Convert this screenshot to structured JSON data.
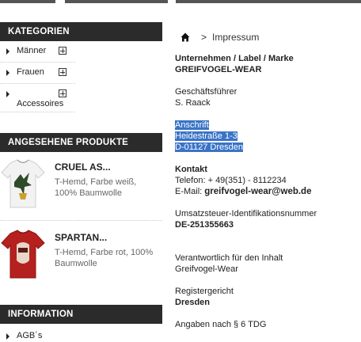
{
  "sidebar": {
    "categories_title": "KATEGORIEN",
    "categories": [
      {
        "label": "Männer"
      },
      {
        "label": "Frauen"
      },
      {
        "label": "Accessoires"
      }
    ],
    "featured_title": "ANGESEHENE PRODUKTE",
    "products": [
      {
        "name": "CRUEL AS...",
        "desc": "T-Hemd, Farbe weiß, 100% Baumwolle",
        "shirt_color": "#f2f2f2"
      },
      {
        "name": "SPARTAN...",
        "desc": "T-Hemd, Farbe rot, 100% Baumwolle",
        "shirt_color": "#b5211e"
      }
    ],
    "information_title": "INFORMATION",
    "information": [
      {
        "label": "AGB´s"
      }
    ]
  },
  "breadcrumb": {
    "page": "Impressum",
    "separator": ">"
  },
  "imprint": {
    "company_label": "Unternehmen / Label / Marke",
    "company_name": "GREIFVOGEL-WEAR",
    "manager_label": "Geschäftsführer",
    "manager_name": "S. Raack",
    "address_label": "Anschrift",
    "street": "Heidestraße 1-3",
    "city": "D-01127 Dresden",
    "contact_label": "Kontakt",
    "phone": "Telefon: + 49(351) - 8112234",
    "email_prefix": "E-Mail: ",
    "email": "greifvogel-wear@web.de",
    "vat_label": "Umsatzsteuer-Identifikationsnummer",
    "vat_id": "DE-251355663",
    "responsible_label": "Verantwortlich für den Inhalt",
    "responsible_name": "Greifvogel-Wear",
    "court_label": "Registergericht",
    "court_city": "Dresden",
    "tdg_note": "Angaben nach § 6 TDG"
  },
  "colors": {
    "header_bar": "#2b2b2b",
    "selection": "#3a73c7"
  }
}
